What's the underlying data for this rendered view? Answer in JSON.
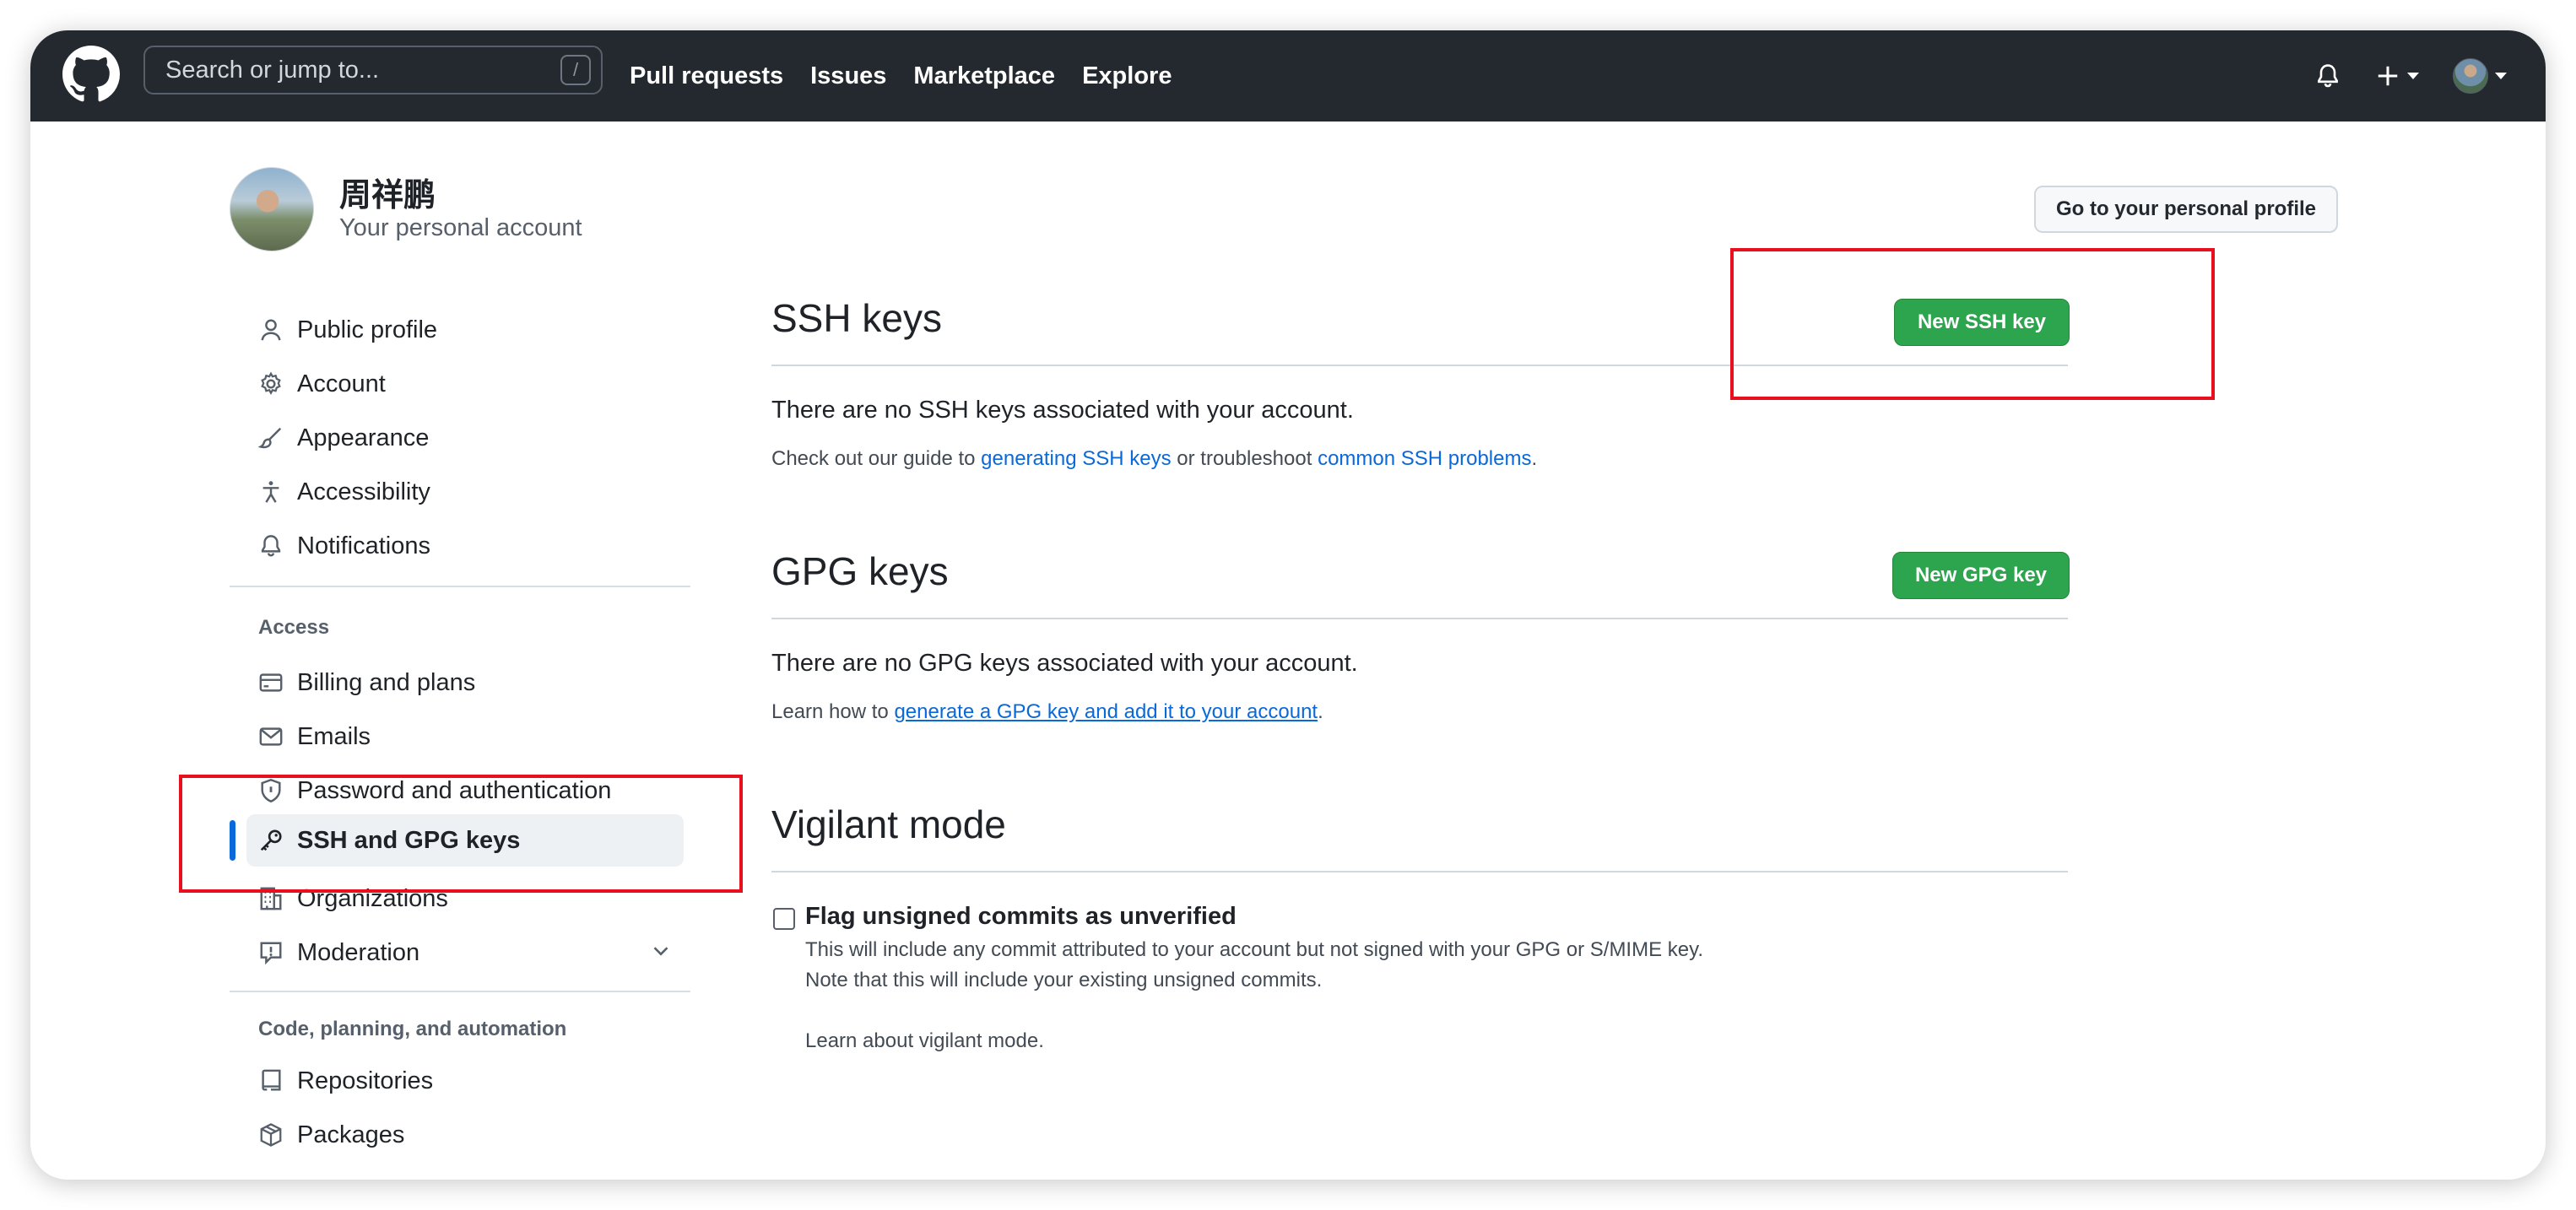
{
  "header": {
    "search_placeholder": "Search or jump to...",
    "search_shortcut": "/",
    "nav": [
      "Pull requests",
      "Issues",
      "Marketplace",
      "Explore"
    ]
  },
  "profile": {
    "name": "周祥鹏",
    "subtitle": "Your personal account",
    "profile_button": "Go to your personal profile"
  },
  "sidebar": {
    "items_top": [
      {
        "label": "Public profile",
        "icon": "person-icon"
      },
      {
        "label": "Account",
        "icon": "gear-icon"
      },
      {
        "label": "Appearance",
        "icon": "paintbrush-icon"
      },
      {
        "label": "Accessibility",
        "icon": "accessibility-icon"
      },
      {
        "label": "Notifications",
        "icon": "bell-icon"
      }
    ],
    "access_heading": "Access",
    "items_access": [
      {
        "label": "Billing and plans",
        "icon": "credit-card-icon"
      },
      {
        "label": "Emails",
        "icon": "mail-icon"
      },
      {
        "label": "Password and authentication",
        "icon": "shield-lock-icon"
      },
      {
        "label": "SSH and GPG keys",
        "icon": "key-icon"
      },
      {
        "label": "Organizations",
        "icon": "organization-icon"
      },
      {
        "label": "Moderation",
        "icon": "report-icon"
      }
    ],
    "code_heading": "Code, planning, and automation",
    "items_code": [
      {
        "label": "Repositories",
        "icon": "repo-icon"
      },
      {
        "label": "Packages",
        "icon": "package-icon"
      }
    ],
    "active_label": "SSH and GPG keys"
  },
  "ssh": {
    "title": "SSH keys",
    "button": "New SSH key",
    "empty": "There are no SSH keys associated with your account.",
    "guide_prefix": "Check out our guide to ",
    "guide_link1": "generating SSH keys",
    "guide_middle": " or troubleshoot ",
    "guide_link2": "common SSH problems",
    "guide_suffix": "."
  },
  "gpg": {
    "title": "GPG keys",
    "button": "New GPG key",
    "empty": "There are no GPG keys associated with your account.",
    "learn_prefix": "Learn how to ",
    "learn_link": "generate a GPG key and add it to your account",
    "learn_suffix": "."
  },
  "vigilant": {
    "title": "Vigilant mode",
    "checkbox_label": "Flag unsigned commits as unverified",
    "checkbox_checked": false,
    "note1": "This will include any commit attributed to your account but not signed with your GPG or S/MIME key.",
    "note2": "Note that this will include your existing unsigned commits.",
    "learn_link": "Learn about vigilant mode."
  },
  "colors": {
    "header_bg": "#24292f",
    "primary_button": "#2da44e",
    "link": "#0969da",
    "annotation": "#e8101f"
  }
}
